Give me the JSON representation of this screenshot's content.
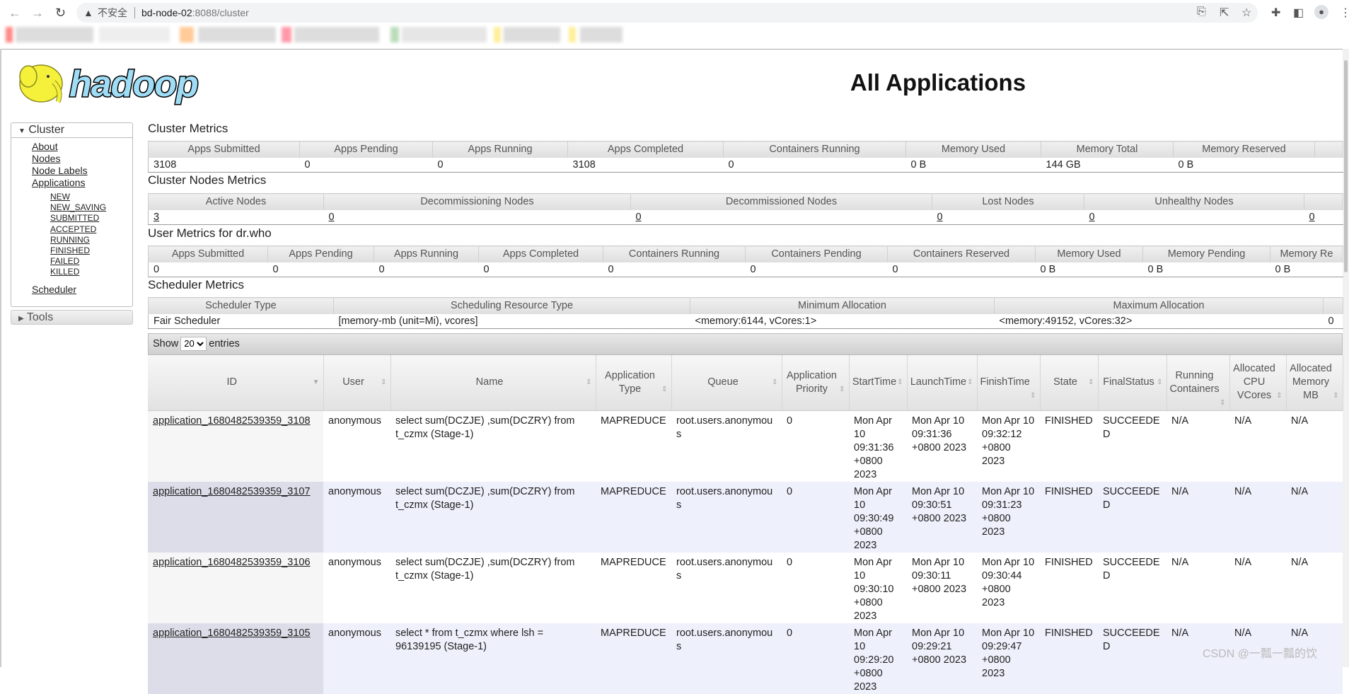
{
  "browser": {
    "security_label": "不安全",
    "url_host": "bd-node-02",
    "url_rest": ":8088/cluster"
  },
  "logo_text": "hadoop",
  "page_title": "All Applications",
  "sidebar": {
    "cluster_label": "Cluster",
    "items": [
      {
        "label": "About"
      },
      {
        "label": "Nodes"
      },
      {
        "label": "Node Labels"
      },
      {
        "label": "Applications"
      }
    ],
    "app_states": [
      "NEW",
      "NEW_SAVING",
      "SUBMITTED",
      "ACCEPTED",
      "RUNNING",
      "FINISHED",
      "FAILED",
      "KILLED"
    ],
    "scheduler_label": "Scheduler",
    "tools_label": "Tools"
  },
  "cluster_metrics": {
    "title": "Cluster Metrics",
    "headers": [
      "Apps Submitted",
      "Apps Pending",
      "Apps Running",
      "Apps Completed",
      "Containers Running",
      "Memory Used",
      "Memory Total",
      "Memory Reserved",
      ""
    ],
    "values": [
      "3108",
      "0",
      "0",
      "3108",
      "0",
      "0 B",
      "144 GB",
      "0 B",
      ""
    ]
  },
  "cluster_nodes_metrics": {
    "title": "Cluster Nodes Metrics",
    "headers": [
      "Active Nodes",
      "Decommissioning Nodes",
      "Decommissioned Nodes",
      "Lost Nodes",
      "Unhealthy Nodes",
      ""
    ],
    "values": [
      "3",
      "0",
      "0",
      "0",
      "0",
      "0"
    ]
  },
  "user_metrics": {
    "title": "User Metrics for dr.who",
    "headers": [
      "Apps Submitted",
      "Apps Pending",
      "Apps Running",
      "Apps Completed",
      "Containers Running",
      "Containers Pending",
      "Containers Reserved",
      "Memory Used",
      "Memory Pending",
      "Memory Re"
    ],
    "values": [
      "0",
      "0",
      "0",
      "0",
      "0",
      "0",
      "0",
      "0 B",
      "0 B",
      "0 B"
    ]
  },
  "scheduler_metrics": {
    "title": "Scheduler Metrics",
    "headers": [
      "Scheduler Type",
      "Scheduling Resource Type",
      "Minimum Allocation",
      "Maximum Allocation",
      ""
    ],
    "values": [
      "Fair Scheduler",
      "[memory-mb (unit=Mi), vcores]",
      "<memory:6144, vCores:1>",
      "<memory:49152, vCores:32>",
      "0"
    ]
  },
  "entries": {
    "show_label": "Show",
    "selected": "20",
    "entries_label": "entries"
  },
  "apps_table": {
    "columns": [
      {
        "label": "ID",
        "sort": "desc"
      },
      {
        "label": "User",
        "sort": "both"
      },
      {
        "label": "Name",
        "sort": "both"
      },
      {
        "label": "Application Type",
        "sort": "both"
      },
      {
        "label": "Queue",
        "sort": "both"
      },
      {
        "label": "Application Priority",
        "sort": "both"
      },
      {
        "label": "StartTime",
        "sort": "both"
      },
      {
        "label": "LaunchTime",
        "sort": "both"
      },
      {
        "label": "FinishTime",
        "sort": "both"
      },
      {
        "label": "State",
        "sort": "both"
      },
      {
        "label": "FinalStatus",
        "sort": "both"
      },
      {
        "label": "Running Containers",
        "sort": "both"
      },
      {
        "label": "Allocated CPU VCores",
        "sort": "both"
      },
      {
        "label": "Allocated Memory MB",
        "sort": "both"
      }
    ],
    "rows": [
      [
        "application_1680482539359_3108",
        "anonymous",
        "select sum(DCZJE) ,sum(DCZRY) from t_czmx (Stage-1)",
        "MAPREDUCE",
        "root.users.anonymous",
        "0",
        "Mon Apr 10 09:31:36 +0800 2023",
        "Mon Apr 10 09:31:36 +0800 2023",
        "Mon Apr 10 09:32:12 +0800 2023",
        "FINISHED",
        "SUCCEEDED",
        "N/A",
        "N/A",
        "N/A"
      ],
      [
        "application_1680482539359_3107",
        "anonymous",
        "select sum(DCZJE) ,sum(DCZRY) from t_czmx (Stage-1)",
        "MAPREDUCE",
        "root.users.anonymous",
        "0",
        "Mon Apr 10 09:30:49 +0800 2023",
        "Mon Apr 10 09:30:51 +0800 2023",
        "Mon Apr 10 09:31:23 +0800 2023",
        "FINISHED",
        "SUCCEEDED",
        "N/A",
        "N/A",
        "N/A"
      ],
      [
        "application_1680482539359_3106",
        "anonymous",
        "select sum(DCZJE) ,sum(DCZRY) from t_czmx (Stage-1)",
        "MAPREDUCE",
        "root.users.anonymous",
        "0",
        "Mon Apr 10 09:30:10 +0800 2023",
        "Mon Apr 10 09:30:11 +0800 2023",
        "Mon Apr 10 09:30:44 +0800 2023",
        "FINISHED",
        "SUCCEEDED",
        "N/A",
        "N/A",
        "N/A"
      ],
      [
        "application_1680482539359_3105",
        "anonymous",
        "select * from t_czmx where lsh = 96139195 (Stage-1)",
        "MAPREDUCE",
        "root.users.anonymous",
        "0",
        "Mon Apr 10 09:29:20 +0800 2023",
        "Mon Apr 10 09:29:21 +0800 2023",
        "Mon Apr 10 09:29:47 +0800 2023",
        "FINISHED",
        "SUCCEEDED",
        "N/A",
        "N/A",
        "N/A"
      ]
    ]
  },
  "watermark": "CSDN @一瓢一瓢的饮"
}
